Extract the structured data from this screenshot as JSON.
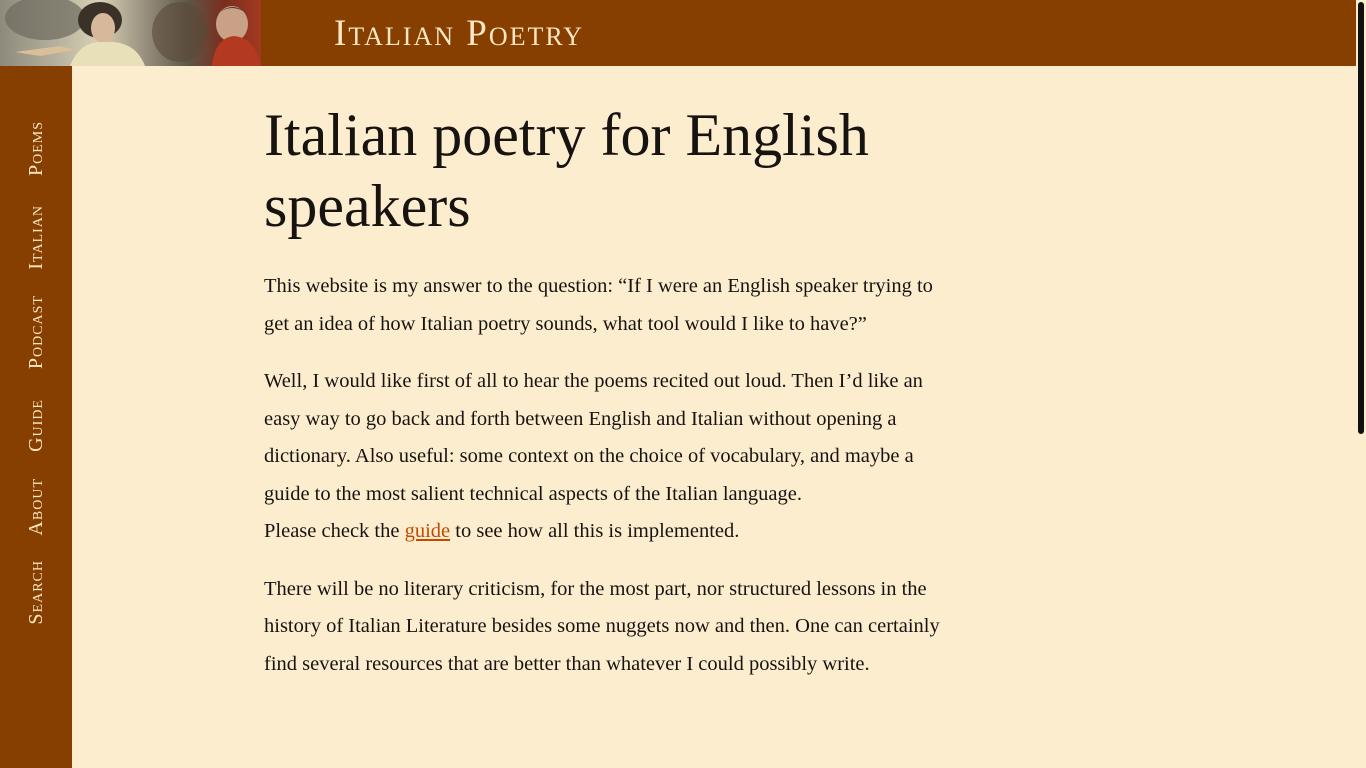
{
  "site": {
    "title": "Italian Poetry"
  },
  "nav": {
    "items": [
      {
        "label": "Poems"
      },
      {
        "label": "Italian"
      },
      {
        "label": "Podcast"
      },
      {
        "label": "Guide"
      },
      {
        "label": "About"
      },
      {
        "label": "Search"
      }
    ]
  },
  "main": {
    "heading": "Italian poetry for English speakers",
    "paragraph1": "This website is my answer to the question: “If I were an English speaker trying to get an idea of how Italian poetry sounds, what tool would I like to have?”",
    "paragraph2": "Well, I would like first of all to hear the poems recited out loud. Then I’d like an easy way to go back and forth between English and Italian without opening a dictionary. Also useful: some context on the choice of vocabulary, and maybe a guide to the most salient technical aspects of the Italian language.",
    "paragraph3_before": "Please check the ",
    "paragraph3_link": "guide",
    "paragraph3_after": " to see how all this is implemented.",
    "paragraph4": "There will be no literary criticism, for the most part, nor structured lessons in the history of Italian Literature besides some nuggets now and then. One can certainly find several resources that are better than whatever I could possibly write."
  },
  "colors": {
    "brand": "#873f00",
    "background": "#fdedcf",
    "link": "#c24a00",
    "nav_text": "#fbe7c6"
  }
}
